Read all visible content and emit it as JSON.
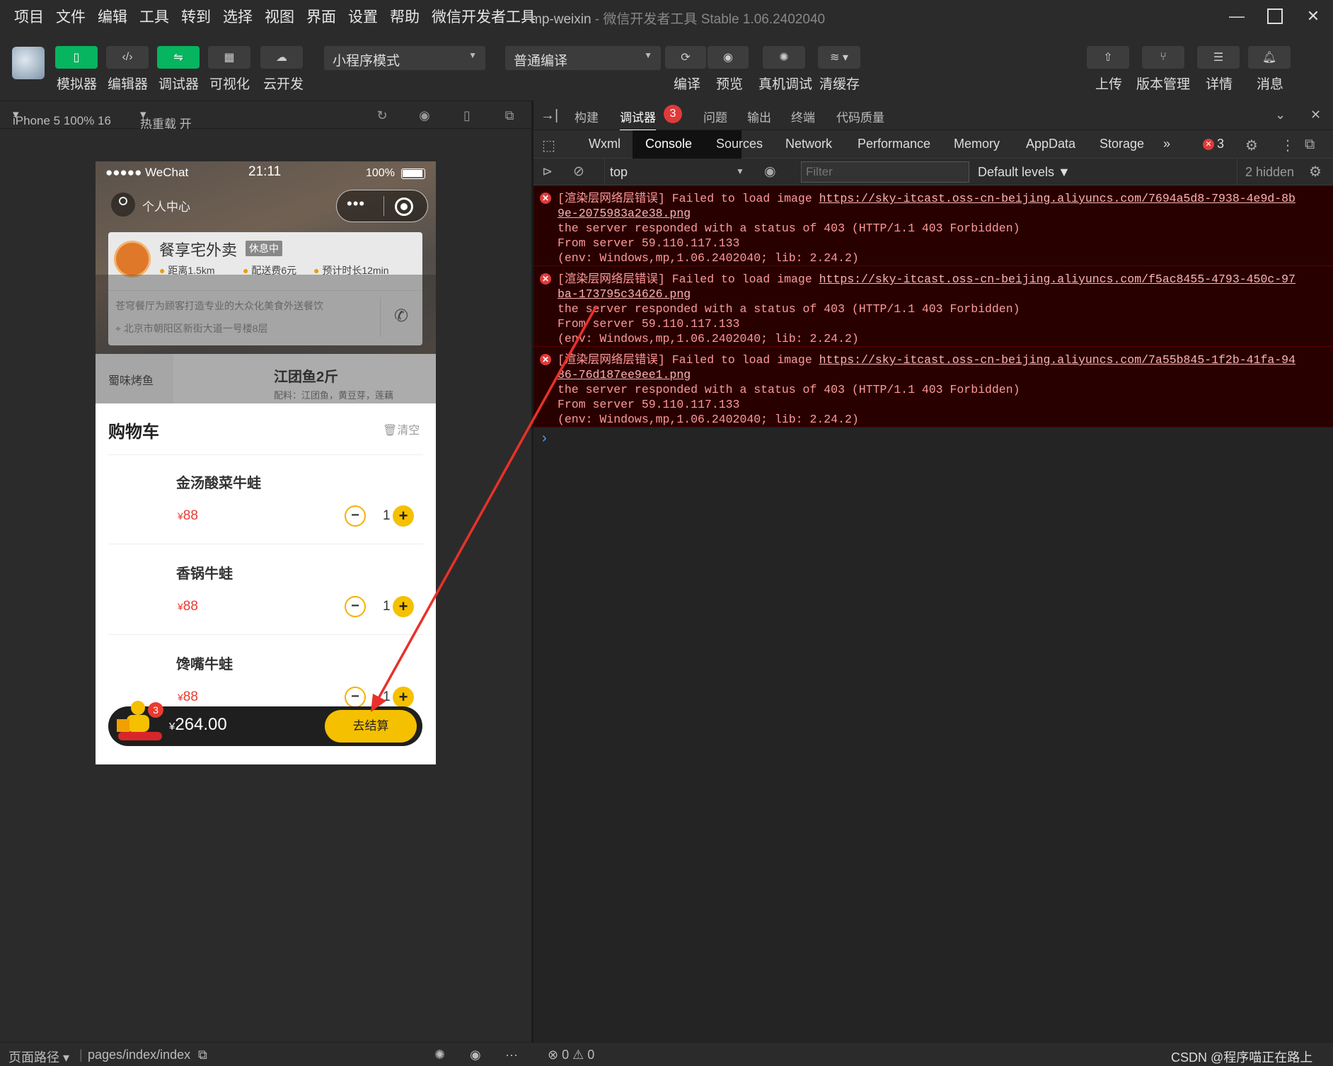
{
  "menu": [
    "项目",
    "文件",
    "编辑",
    "工具",
    "转到",
    "选择",
    "视图",
    "界面",
    "设置",
    "帮助",
    "微信开发者工具"
  ],
  "window": {
    "title": "mp-weixin",
    "subtitle": " - 微信开发者工具 Stable 1.06.2402040"
  },
  "toolbar": {
    "left_buttons": [
      "模拟器",
      "编辑器",
      "调试器",
      "可视化",
      "云开发"
    ],
    "mode_select": "小程序模式",
    "compile_select": "普通编译",
    "mid_buttons": [
      "编译",
      "预览",
      "真机调试",
      "清缓存"
    ],
    "right_buttons": [
      "上传",
      "版本管理",
      "详情",
      "消息"
    ]
  },
  "simulator": {
    "device": "iPhone 5 100% 16",
    "hot_reload": "热重载 开"
  },
  "phone": {
    "carrier": "●●●●● WeChat",
    "time": "21:11",
    "battery": "100%",
    "profile": "个人中心",
    "shop_name": "餐享宅外卖",
    "shop_status": "休息中",
    "distance": "距离1.5km",
    "delivery_fee": "配送费6元",
    "eta": "预计时长12min",
    "desc": "苍穹餐厅为顾客打造专业的大众化美食外送餐饮",
    "address": "北京市朝阳区新街大道一号楼8层",
    "category": "蜀味烤鱼",
    "dish_title": "江团鱼2斤",
    "dish_sub": "配料：江团鱼，黄豆芽，莲藕",
    "cart_title": "购物车",
    "clear": "清空",
    "items": [
      {
        "name": "金汤酸菜牛蛙",
        "price": "88",
        "qty": "1"
      },
      {
        "name": "香锅牛蛙",
        "price": "88",
        "qty": "1"
      },
      {
        "name": "馋嘴牛蛙",
        "price": "88",
        "qty": "1"
      }
    ],
    "currency": "¥",
    "badge": "3",
    "total": "264.00",
    "checkout": "去结算"
  },
  "devtools": {
    "top_tabs": [
      "构建",
      "调试器",
      "问题",
      "输出",
      "终端",
      "代码质量"
    ],
    "debugger_badge": "3",
    "sub_tabs": [
      "Wxml",
      "Console",
      "Sources",
      "Network",
      "Performance",
      "Memory",
      "AppData",
      "Storage"
    ],
    "more": "»",
    "error_count": "3",
    "context": "top",
    "filter_placeholder": "Filter",
    "levels": "Default levels ▼",
    "hidden": "2 hidden",
    "errors": [
      {
        "prefix": "[渲染层网络层错误] Failed to load image ",
        "url1": "https://sky-itcast.oss-cn-beijing.aliyuncs.com/7694a5d8-7938-4e9d-8b",
        "url2": "9e-2075983a2e38.png",
        "l3": "the server responded with a status of 403 (HTTP/1.1 403 Forbidden)",
        "l4": "From server 59.110.117.133",
        "l5": "(env: Windows,mp,1.06.2402040; lib: 2.24.2)"
      },
      {
        "prefix": "[渲染层网络层错误] Failed to load image ",
        "url1": "https://sky-itcast.oss-cn-beijing.aliyuncs.com/f5ac8455-4793-450c-97",
        "url2": "ba-173795c34626.png",
        "l3": "the server responded with a status of 403 (HTTP/1.1 403 Forbidden)",
        "l4": "From server 59.110.117.133",
        "l5": "(env: Windows,mp,1.06.2402040; lib: 2.24.2)"
      },
      {
        "prefix": "[渲染层网络层错误] Failed to load image ",
        "url1": "https://sky-itcast.oss-cn-beijing.aliyuncs.com/7a55b845-1f2b-41fa-94",
        "url2": "86-76d187ee9ee1.png",
        "l3": "the server responded with a status of 403 (HTTP/1.1 403 Forbidden)",
        "l4": "From server 59.110.117.133",
        "l5": "(env: Windows,mp,1.06.2402040; lib: 2.24.2)"
      }
    ],
    "prompt": "›"
  },
  "status": {
    "page_path_label": "页面路径 ▾",
    "page_path": "pages/index/index",
    "errors": "⊗ 0 ⚠ 0",
    "watermark": "CSDN @程序喵正在路上"
  },
  "colors": {
    "accent_green": "#07b45f",
    "error_bg": "#290000",
    "error_text": "#ff8f8f",
    "price_red": "#e83b30",
    "yellow": "#f5c000",
    "arrow_red": "#e8312a"
  }
}
